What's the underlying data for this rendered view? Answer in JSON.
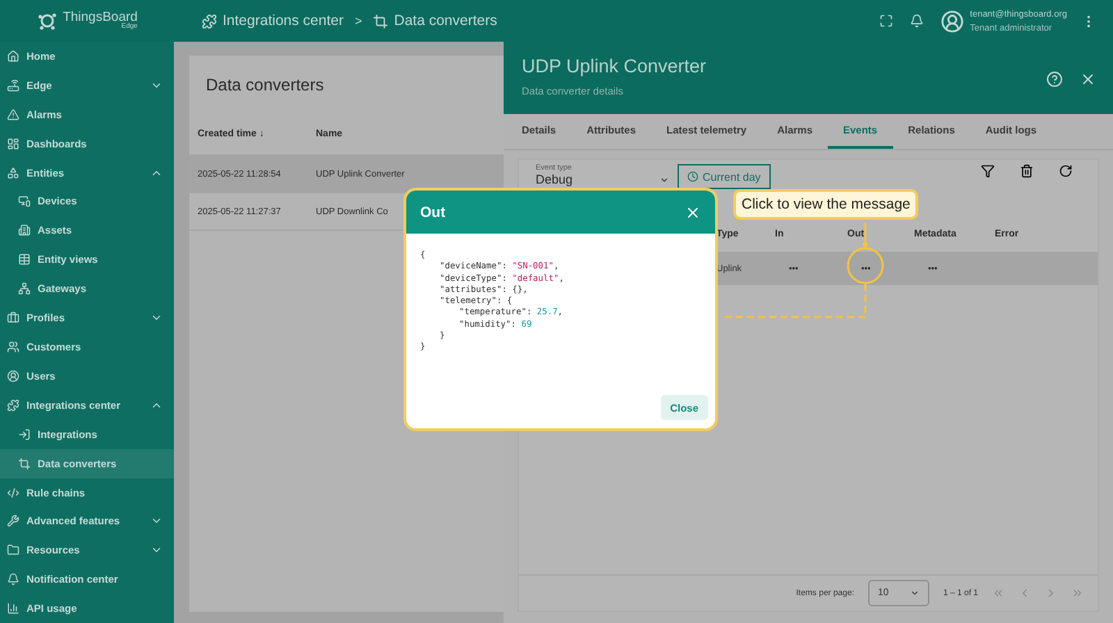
{
  "header": {
    "logo": {
      "name": "ThingsBoard",
      "edition": "Edge"
    },
    "breadcrumbs": [
      "Integrations center",
      "Data converters"
    ],
    "breadcrumb_separator": ">",
    "user": {
      "email": "tenant@thingsboard.org",
      "role": "Tenant administrator"
    }
  },
  "sidebar": {
    "items": [
      {
        "label": "Home",
        "selected": false
      },
      {
        "label": "Edge",
        "selected": false,
        "expanded": false
      },
      {
        "label": "Alarms",
        "selected": false
      },
      {
        "label": "Dashboards",
        "selected": false
      },
      {
        "label": "Entities",
        "selected": false,
        "expanded": true,
        "children": [
          {
            "label": "Devices",
            "selected": false
          },
          {
            "label": "Assets",
            "selected": false
          },
          {
            "label": "Entity views",
            "selected": false
          },
          {
            "label": "Gateways",
            "selected": false
          }
        ]
      },
      {
        "label": "Profiles",
        "selected": false,
        "expanded": false
      },
      {
        "label": "Customers",
        "selected": false
      },
      {
        "label": "Users",
        "selected": false
      },
      {
        "label": "Integrations center",
        "selected": false,
        "expanded": true,
        "children": [
          {
            "label": "Integrations",
            "selected": false
          },
          {
            "label": "Data converters",
            "selected": true
          }
        ]
      },
      {
        "label": "Rule chains",
        "selected": false
      },
      {
        "label": "Advanced features",
        "selected": false,
        "expanded": false
      },
      {
        "label": "Resources",
        "selected": false,
        "expanded": false
      },
      {
        "label": "Notification center",
        "selected": false
      },
      {
        "label": "API usage",
        "selected": false
      }
    ]
  },
  "list": {
    "title": "Data converters",
    "columns": [
      "Created time ↓",
      "Name"
    ],
    "rows": [
      {
        "cells": [
          "2025-05-22 11:28:54",
          "UDP Uplink Converter"
        ],
        "selected": true
      },
      {
        "cells": [
          "2025-05-22 11:27:37",
          "UDP Downlink Co"
        ],
        "selected": false
      }
    ]
  },
  "details": {
    "title": "UDP Uplink Converter",
    "subtitle": "Data converter details",
    "tabs": [
      {
        "label": "Details",
        "selected": false
      },
      {
        "label": "Attributes",
        "selected": false
      },
      {
        "label": "Latest telemetry",
        "selected": false
      },
      {
        "label": "Alarms",
        "selected": false
      },
      {
        "label": "Events",
        "selected": true
      },
      {
        "label": "Relations",
        "selected": false
      },
      {
        "label": "Audit logs",
        "selected": false
      }
    ],
    "event_type": {
      "label": "Event type",
      "value": "Debug"
    },
    "time_button": "Current day",
    "columns": [
      "Type",
      "In",
      "Out",
      "Metadata",
      "Error"
    ],
    "rows": [
      {
        "cells": [
          "Uplink",
          "•••",
          "•••",
          "•••",
          ""
        ],
        "selected": true
      }
    ],
    "pagination": {
      "label": "Items per page:",
      "page_size": "10",
      "range": "1 – 1 of 1"
    }
  },
  "dialog": {
    "title": "Out",
    "close": "Close",
    "code": [
      [
        {
          "kind": "punct",
          "text": "{"
        }
      ],
      [
        {
          "kind": "key",
          "text": "\"deviceName\""
        },
        {
          "kind": "punct",
          "text": ": "
        },
        {
          "kind": "string",
          "text": "\"SN-001\""
        },
        {
          "kind": "punct",
          "text": ","
        }
      ],
      [
        {
          "kind": "key",
          "text": "\"deviceType\""
        },
        {
          "kind": "punct",
          "text": ": "
        },
        {
          "kind": "string",
          "text": "\"default\""
        },
        {
          "kind": "punct",
          "text": ","
        }
      ],
      [
        {
          "kind": "key",
          "text": "\"attributes\""
        },
        {
          "kind": "punct",
          "text": ": {},"
        }
      ],
      [
        {
          "kind": "key",
          "text": "\"telemetry\""
        },
        {
          "kind": "punct",
          "text": ": {"
        }
      ],
      [
        {
          "kind": "key",
          "text": "\"temperature\""
        },
        {
          "kind": "punct",
          "text": ": "
        },
        {
          "kind": "number",
          "text": "25.7"
        },
        {
          "kind": "punct",
          "text": ","
        }
      ],
      [
        {
          "kind": "key",
          "text": "\"humidity\""
        },
        {
          "kind": "punct",
          "text": ": "
        },
        {
          "kind": "number",
          "text": "69"
        }
      ],
      [
        {
          "kind": "punct",
          "text": "}"
        }
      ],
      [
        {
          "kind": "punct",
          "text": "}"
        }
      ]
    ]
  },
  "callout": {
    "text": "Click to view the message"
  }
}
